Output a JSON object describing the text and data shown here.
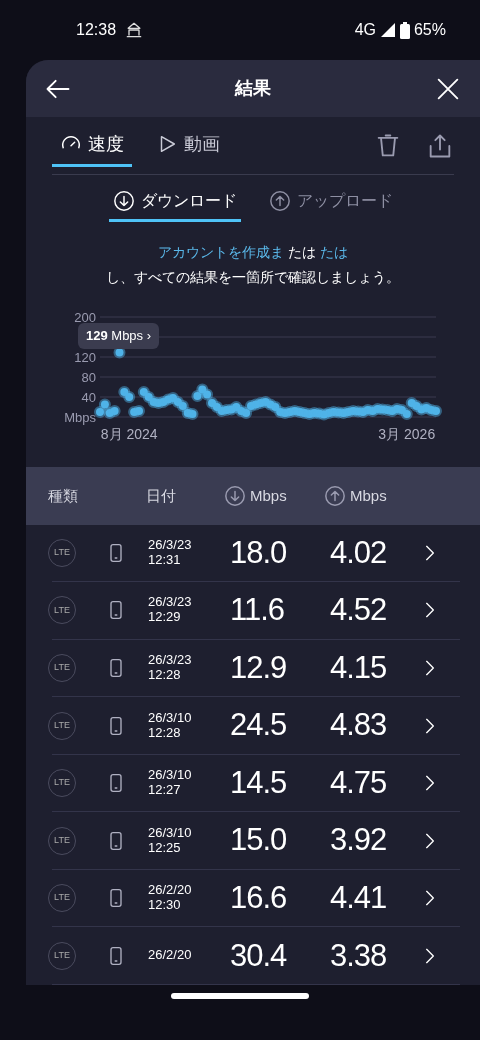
{
  "status_bar": {
    "time": "12:38",
    "network": "4G",
    "battery": "65%"
  },
  "header": {
    "title": "結果"
  },
  "tabs": [
    {
      "label": "速度",
      "kind": "speed",
      "selected": true
    },
    {
      "label": "動画",
      "kind": "video",
      "selected": false
    }
  ],
  "direction_tabs": [
    {
      "label": "ダウンロード",
      "kind": "down",
      "selected": true
    },
    {
      "label": "アップロード",
      "kind": "up",
      "selected": false
    }
  ],
  "message": {
    "segments": [
      {
        "text": "アカウントを作成ま",
        "link": true
      },
      {
        "text": " たは ",
        "link": false
      },
      {
        "text": "たは",
        "link": true
      }
    ],
    "line2": "し、すべての結果を一箇所で確認しましょう。"
  },
  "tooltip": "**129** Mbps ›",
  "chart_data": {
    "type": "scatter",
    "grid": true,
    "ylim": [
      0,
      200
    ],
    "categories": [
      null,
      null,
      null,
      null,
      null,
      null,
      "8月 2024",
      null,
      null,
      null,
      null,
      null,
      null,
      null,
      null,
      null,
      null,
      null,
      null,
      null,
      null,
      null,
      null,
      null,
      null,
      null,
      null,
      null,
      null,
      null,
      null,
      null,
      null,
      null,
      null,
      null,
      null,
      null,
      null,
      null,
      null,
      null,
      null,
      null,
      null,
      null,
      null,
      null,
      null,
      null,
      null,
      null,
      null,
      null,
      null,
      null,
      null,
      null,
      null,
      null,
      null,
      null,
      null,
      "3月 2026",
      null,
      null,
      null,
      null,
      null,
      null
    ],
    "yticks": [
      {
        "value": 0,
        "label": "Mbps"
      },
      {
        "value": 40,
        "label": "40"
      },
      {
        "value": 80,
        "label": "80"
      },
      {
        "value": 120,
        "label": "120"
      },
      {
        "value": 200,
        "label": "200"
      }
    ],
    "series": [
      {
        "color": "#4fb3e8",
        "values": [
          10,
          25,
          8,
          12,
          129,
          50,
          40,
          10,
          12,
          50,
          40,
          30,
          28,
          30,
          35,
          38,
          30,
          22,
          8,
          6,
          42,
          55,
          45,
          28,
          20,
          12,
          14,
          15,
          20,
          12,
          8,
          22,
          25,
          28,
          30,
          25,
          20,
          10,
          8,
          10,
          12,
          10,
          8,
          6,
          8,
          7,
          5,
          8,
          10,
          9,
          8,
          10,
          12,
          11,
          10,
          14,
          12,
          16,
          15,
          14,
          12,
          16,
          14,
          6,
          28,
          22,
          15,
          18,
          14,
          12
        ]
      }
    ]
  },
  "table": {
    "columns": [
      {
        "label": "種類",
        "kind": "text"
      },
      {
        "label": "日付",
        "kind": "text"
      },
      {
        "label": "Mbps",
        "kind": "down"
      },
      {
        "label": "Mbps",
        "kind": "up"
      }
    ],
    "rows": [
      {
        "type": "LTE",
        "date": "26/3/23",
        "time": "12:31",
        "download": "18.0",
        "upload": "4.02"
      },
      {
        "type": "LTE",
        "date": "26/3/23",
        "time": "12:29",
        "download": "11.6",
        "upload": "4.52"
      },
      {
        "type": "LTE",
        "date": "26/3/23",
        "time": "12:28",
        "download": "12.9",
        "upload": "4.15"
      },
      {
        "type": "LTE",
        "date": "26/3/10",
        "time": "12:28",
        "download": "24.5",
        "upload": "4.83"
      },
      {
        "type": "LTE",
        "date": "26/3/10",
        "time": "12:27",
        "download": "14.5",
        "upload": "4.75"
      },
      {
        "type": "LTE",
        "date": "26/3/10",
        "time": "12:25",
        "download": "15.0",
        "upload": "3.92"
      },
      {
        "type": "LTE",
        "date": "26/2/20",
        "time": "12:30",
        "download": "16.6",
        "upload": "4.41"
      },
      {
        "type": "LTE",
        "date": "26/2/20",
        "download": "30.4",
        "upload": "3.38"
      }
    ]
  }
}
